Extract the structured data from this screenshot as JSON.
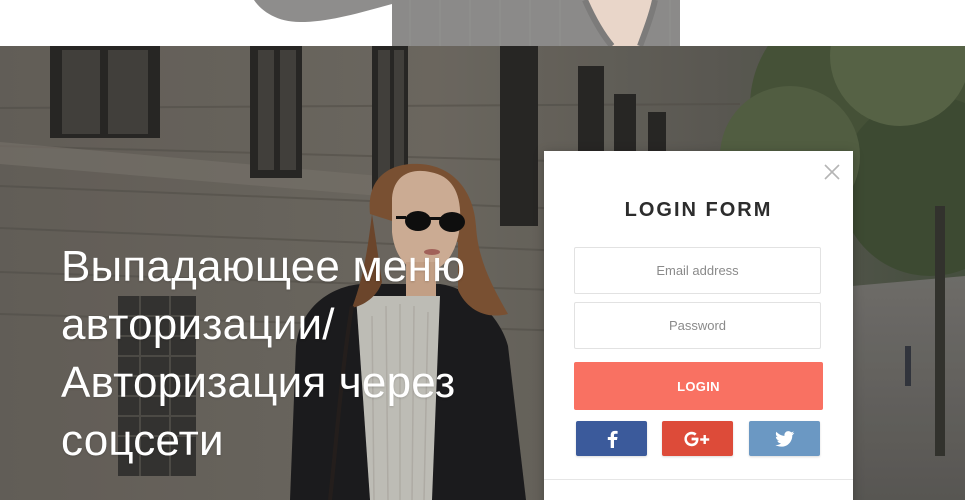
{
  "hero": {
    "title_lines": [
      "Выпадающее меню",
      "авторизации/",
      "Авторизация через",
      "соцсети"
    ]
  },
  "login_form": {
    "title": "LOGIN FORM",
    "email_placeholder": "Email address",
    "password_placeholder": "Password",
    "login_label": "LOGIN",
    "social": [
      {
        "name": "facebook",
        "glyph": "f",
        "color": "#3b5a9b"
      },
      {
        "name": "google-plus",
        "glyph": "G+",
        "color": "#dd4b39"
      },
      {
        "name": "twitter",
        "glyph": "twitter-bird",
        "color": "#6b98c3"
      }
    ],
    "accent_color": "#f97162"
  }
}
